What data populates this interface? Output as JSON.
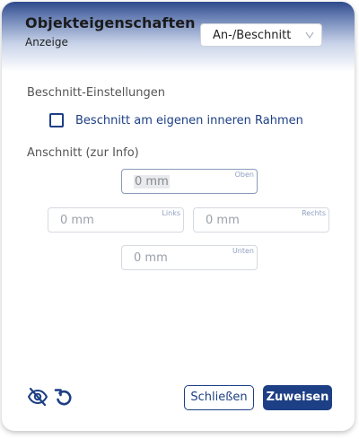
{
  "dialog": {
    "title": "Objekteigenschaften",
    "subtitle": "Anzeige",
    "mode_select": {
      "value": "An-/Beschnitt",
      "icon": "chevron-down-icon"
    }
  },
  "trim": {
    "section_label": "Beschnitt-Einstellungen",
    "checkbox_label": "Beschnitt am eigenen inneren Rahmen",
    "checked": false
  },
  "bleed": {
    "section_label": "Anschnitt (zur Info)",
    "top": {
      "value": "0 mm",
      "caption": "Oben"
    },
    "left": {
      "value": "0 mm",
      "caption": "Links"
    },
    "right": {
      "value": "0 mm",
      "caption": "Rechts"
    },
    "bottom": {
      "value": "0 mm",
      "caption": "Unten"
    }
  },
  "footer": {
    "visibility_icon": "eye-off-icon",
    "reset_icon": "undo-icon",
    "close_label": "Schließen",
    "apply_label": "Zuweisen"
  },
  "colors": {
    "accent": "#1d3f85",
    "header_top": "#2e4a8b"
  }
}
